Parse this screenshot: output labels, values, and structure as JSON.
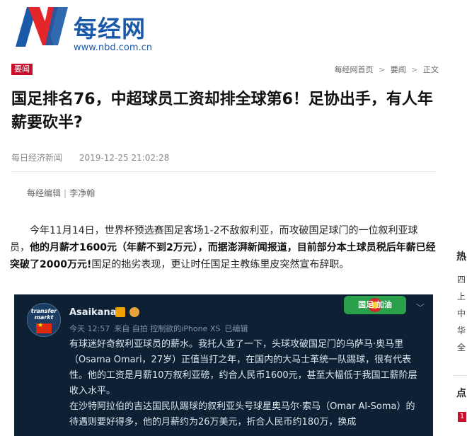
{
  "header": {
    "brand_name": "每经网",
    "brand_url": "www.nbd.com.cn",
    "logo_icon": "nbd-n-logo"
  },
  "tag": "要闻",
  "breadcrumb": [
    "每经网首页",
    "要闻",
    "正文"
  ],
  "breadcrumb_sep": ">",
  "article": {
    "title": "国足排名76，中超球员工资却排全球第6！足协出手，有人年薪要砍半?",
    "source": "每日经济新闻",
    "datetime": "2019-12-25 21:02:28",
    "editor_label": "每经编辑",
    "editor_name": "李净翰",
    "para_part1": "今年11月14日，世界杯预选赛国足客场1-2不敌叙利亚，而攻破国足球门的一位叙利亚球员，",
    "para_bold": "他的月薪才1600元（年薪不到2万元），而据澎湃新闻报道，目前部分本土球员税后年薪已经突破了2000万元!",
    "para_part2": "国足的拙劣表现，更让时任国足主教练里皮突然宣布辞职。"
  },
  "weibo_card": {
    "avatar_text": "transfer markt",
    "username": "Asaikana",
    "time": "今天 12:57",
    "from": "来自 自拍 控制欲的iPhone XS",
    "edited": "已编辑",
    "badge_text": "国足 加油",
    "body": "有球迷好奇叙利亚球员的薪水。我托人查了一下，头球攻破国足门的乌萨马·奥马里（Osama Omari，27岁）正值当打之年，在国内的大马士革统一队踢球，很有代表性。他的工资是月薪10万叙利亚磅，约合人民币1600元，甚至大幅低于我国工薪阶层收入水平。\n在沙特阿拉伯的吉达国民队踢球的叙利亚头号球星奥马尔·索马（Omar Al-Soma）的待遇则要好得多，他的月薪约为26万美元，折合人民币约180万，换成"
  },
  "sidebar": {
    "header1": "热",
    "items": [
      "四",
      "上",
      "中",
      "华",
      "全"
    ],
    "header2": "点",
    "num": "1"
  },
  "colors": {
    "brand_blue": "#1a5aa8",
    "accent_red": "#c8102e",
    "card_bg": "#0d2034"
  }
}
